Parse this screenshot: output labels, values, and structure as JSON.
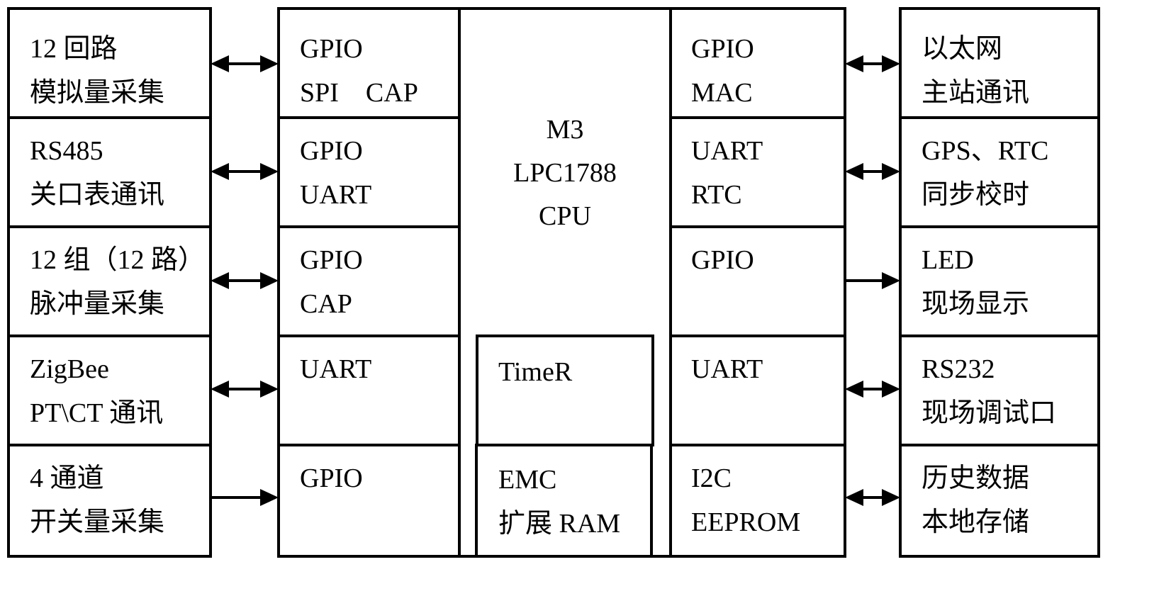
{
  "diagram": {
    "title": "",
    "left_modules": [
      {
        "line1": "12 回路",
        "line2": "模拟量采集",
        "arrow": "bidirectional"
      },
      {
        "line1": "RS485",
        "line2": "关口表通讯",
        "arrow": "bidirectional"
      },
      {
        "line1": "12 组（12 路）",
        "line2": "脉冲量采集",
        "arrow": "bidirectional"
      },
      {
        "line1": "ZigBee",
        "line2": "PT\\CT 通讯",
        "arrow": "bidirectional"
      },
      {
        "line1": "4 通道",
        "line2": "开关量采集",
        "arrow": "to-cpu"
      }
    ],
    "left_interfaces": [
      {
        "line1": "GPIO",
        "line2": "SPI    CAP"
      },
      {
        "line1": "GPIO",
        "line2": "UART"
      },
      {
        "line1": "GPIO",
        "line2": "CAP"
      },
      {
        "line1": "UART",
        "line2": ""
      },
      {
        "line1": "GPIO",
        "line2": ""
      }
    ],
    "cpu": {
      "line1": "M3",
      "line2": "LPC1788",
      "line3": "CPU"
    },
    "timer": {
      "line1": "TimeR"
    },
    "emc": {
      "line1": "EMC",
      "line2": "扩展 RAM"
    },
    "right_interfaces": [
      {
        "line1": "GPIO",
        "line2": "MAC"
      },
      {
        "line1": "UART",
        "line2": "RTC"
      },
      {
        "line1": "GPIO",
        "line2": ""
      },
      {
        "line1": "UART",
        "line2": ""
      },
      {
        "line1": "I2C",
        "line2": "EEPROM"
      }
    ],
    "right_modules": [
      {
        "line1": "以太网",
        "line2": "主站通讯",
        "arrow": "bidirectional"
      },
      {
        "line1": "GPS、RTC",
        "line2": "同步校时",
        "arrow": "bidirectional"
      },
      {
        "line1": "LED",
        "line2": "现场显示",
        "arrow": "from-cpu"
      },
      {
        "line1": "RS232",
        "line2": "现场调试口",
        "arrow": "bidirectional"
      },
      {
        "line1": "历史数据",
        "line2": "本地存储",
        "arrow": "bidirectional"
      }
    ]
  }
}
